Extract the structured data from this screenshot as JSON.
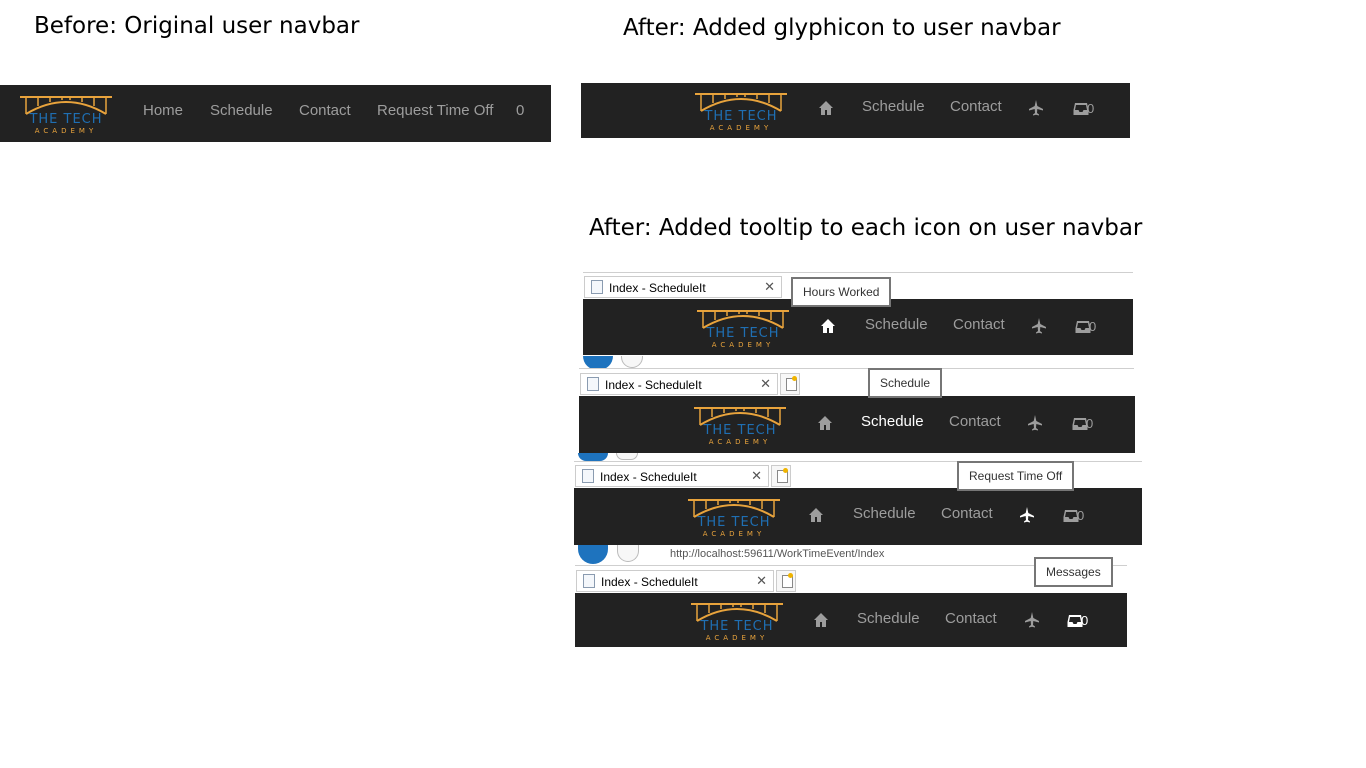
{
  "headings": {
    "before": "Before: Original user navbar",
    "after_glyph": "After: Added glyphicon to user navbar",
    "after_tooltip": "After: Added tooltip to each icon on user navbar"
  },
  "logo": {
    "title": "THE TECH",
    "subtitle": "ACADEMY"
  },
  "colors": {
    "navbar_bg": "#222222",
    "nav_text": "#9d9d9d",
    "nav_active": "#ffffff",
    "logo_gold": "#e8a33c",
    "logo_blue": "#1f6fb3"
  },
  "before_nav": {
    "links": [
      "Home",
      "Schedule",
      "Contact",
      "Request Time Off"
    ],
    "badge": "0"
  },
  "glyph_nav": {
    "home_icon": "home-icon",
    "schedule": "Schedule",
    "contact": "Contact",
    "timeoff_icon": "plane-icon",
    "messages_icon": "inbox-icon",
    "badge": "0"
  },
  "tab_title": "Index - ScheduleIt",
  "address_url": "http://localhost:59611/WorkTimeEvent/Index",
  "tooltips": {
    "hours_worked": "Hours Worked",
    "schedule": "Schedule",
    "request_time_off": "Request Time Off",
    "messages": "Messages"
  }
}
